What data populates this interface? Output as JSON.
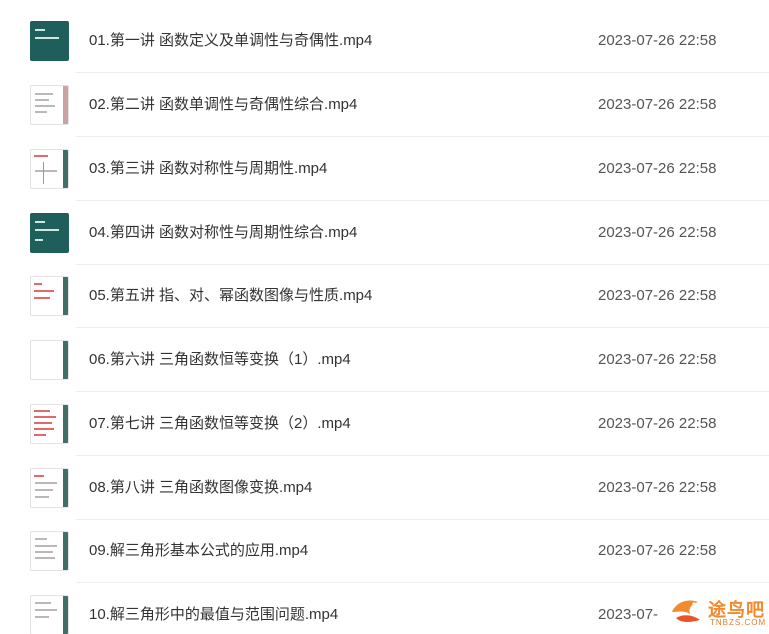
{
  "files": [
    {
      "name": "01.第一讲 函数定义及单调性与奇偶性.mp4",
      "date": "2023-07-26 22:58",
      "thumb_icon": "video-thumbnail-icon"
    },
    {
      "name": "02.第二讲 函数单调性与奇偶性综合.mp4",
      "date": "2023-07-26 22:58",
      "thumb_icon": "video-thumbnail-icon"
    },
    {
      "name": "03.第三讲 函数对称性与周期性.mp4",
      "date": "2023-07-26 22:58",
      "thumb_icon": "video-thumbnail-icon"
    },
    {
      "name": "04.第四讲 函数对称性与周期性综合.mp4",
      "date": "2023-07-26 22:58",
      "thumb_icon": "video-thumbnail-icon"
    },
    {
      "name": "05.第五讲 指、对、幂函数图像与性质.mp4",
      "date": "2023-07-26 22:58",
      "thumb_icon": "video-thumbnail-icon"
    },
    {
      "name": "06.第六讲 三角函数恒等变换（1）.mp4",
      "date": "2023-07-26 22:58",
      "thumb_icon": "video-thumbnail-icon"
    },
    {
      "name": "07.第七讲 三角函数恒等变换（2）.mp4",
      "date": "2023-07-26 22:58",
      "thumb_icon": "video-thumbnail-icon"
    },
    {
      "name": "08.第八讲 三角函数图像变换.mp4",
      "date": "2023-07-26 22:58",
      "thumb_icon": "video-thumbnail-icon"
    },
    {
      "name": "09.解三角形基本公式的应用.mp4",
      "date": "2023-07-26 22:58",
      "thumb_icon": "video-thumbnail-icon"
    },
    {
      "name": "10.解三角形中的最值与范围问题.mp4",
      "date": "2023-07-",
      "thumb_icon": "video-thumbnail-icon"
    }
  ],
  "watermark": {
    "title": "途鸟吧",
    "subtitle": "TNBZS.COM",
    "icon": "bird-logo-icon"
  },
  "colors": {
    "text": "#333333",
    "date": "#555555",
    "divider": "#eceef2",
    "thumb_teal": "#1f5f5b",
    "watermark": "#f28a2e"
  }
}
